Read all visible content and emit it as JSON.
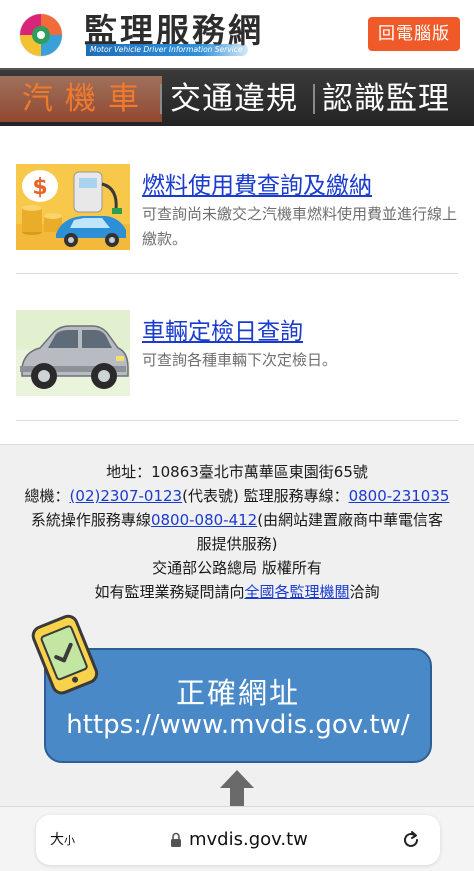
{
  "header": {
    "logo_title": "監理服務網",
    "logo_subtitle": "Motor Vehicle Driver Information Service",
    "desktop_button": "回電腦版"
  },
  "nav": {
    "items": [
      {
        "label": "汽機車",
        "active": true
      },
      {
        "label": "交通違規",
        "active": false
      },
      {
        "label": "認識監理",
        "active": false
      }
    ],
    "active_color": "#f07a2a"
  },
  "services": [
    {
      "title": "燃料使用費查詢及繳納",
      "description": "可查詢尚未繳交之汽機車燃料使用費並進行線上繳款。",
      "icon": "fuel-fee-car-coins-image"
    },
    {
      "title": "車輛定檢日查詢",
      "description": "可查詢各種車輛下次定檢日。",
      "icon": "car-image"
    }
  ],
  "footer": {
    "address": "地址：10863臺北市萬華區東園街65號",
    "phone_label": "總機：",
    "phone": "(02)2307-0123",
    "phone_suffix": "(代表號) 監理服務專線：",
    "hotline": "0800-231035",
    "support_label": "系統操作服務專線",
    "support_phone": "0800-080-412",
    "support_suffix": "(由網站建置廠商中華電信客",
    "support_suffix2": "服提供服務)",
    "copyright": "交通部公路總局 版權所有",
    "inquiry_prefix": "如有監理業務疑問請向",
    "inquiry_link": "全國各監理機關",
    "inquiry_suffix": "洽詢"
  },
  "overlay": {
    "title": "正確網址",
    "url": "https://www.mvdis.gov.tw/"
  },
  "browser": {
    "text_size_big": "大",
    "text_size_small": "小",
    "domain": "mvdis.gov.tw"
  },
  "colors": {
    "link": "#1a3bcf",
    "accent_orange": "#ef5a28",
    "overlay_blue": "#4a89c8"
  }
}
